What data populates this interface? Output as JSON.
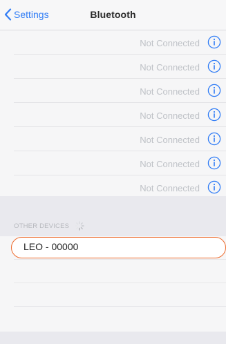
{
  "colors": {
    "accent": "#2f7cf6",
    "highlight_ring": "#ee6a2b",
    "background": "#efeff4"
  },
  "navbar": {
    "back_icon": "chevron-left-icon",
    "back_label": "Settings",
    "title": "Bluetooth"
  },
  "my_devices": [
    {
      "name": "",
      "status": "Not Connected",
      "icon": "info-icon"
    },
    {
      "name": "",
      "status": "Not Connected",
      "icon": "info-icon"
    },
    {
      "name": "",
      "status": "Not Connected",
      "icon": "info-icon"
    },
    {
      "name": "",
      "status": "Not Connected",
      "icon": "info-icon"
    },
    {
      "name": "",
      "status": "Not Connected",
      "icon": "info-icon"
    },
    {
      "name": "",
      "status": "Not Connected",
      "icon": "info-icon"
    },
    {
      "name": "",
      "status": "Not Connected",
      "icon": "info-icon"
    }
  ],
  "other_devices": {
    "title": "OTHER DEVICES",
    "spinner_icon": "activity-spinner-icon",
    "items": [
      {
        "name": "LEO - 00000",
        "highlighted": true
      }
    ]
  }
}
